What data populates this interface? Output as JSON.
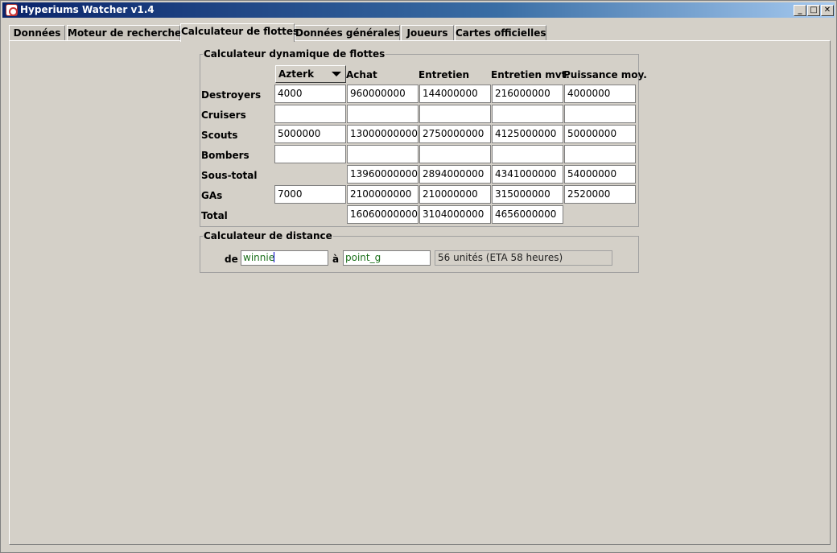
{
  "window": {
    "title": "Hyperiums Watcher v1.4",
    "minimize": "_",
    "maximize": "□",
    "close": "✕"
  },
  "tabs": [
    "Données",
    "Moteur de recherche",
    "Calculateur de flottes",
    "Données générales",
    "Joueurs",
    "Cartes officielles"
  ],
  "active_tab": "Calculateur de flottes",
  "fleet_calc": {
    "legend": "Calculateur dynamique de flottes",
    "race": "Azterk",
    "headers": [
      "Achat",
      "Entretien",
      "Entretien mvt.",
      "Puissance moy."
    ],
    "rows": [
      {
        "label": "Destroyers",
        "qty": "4000",
        "values": [
          "960000000",
          "144000000",
          "216000000",
          "4000000"
        ]
      },
      {
        "label": "Cruisers",
        "qty": "",
        "values": [
          "",
          "",
          "",
          ""
        ]
      },
      {
        "label": "Scouts",
        "qty": "5000000",
        "values": [
          "13000000000",
          "2750000000",
          "4125000000",
          "50000000"
        ]
      },
      {
        "label": "Bombers",
        "qty": "",
        "values": [
          "",
          "",
          "",
          ""
        ]
      }
    ],
    "subtotal": {
      "label": "Sous-total",
      "values": [
        "13960000000",
        "2894000000",
        "4341000000",
        "54000000"
      ]
    },
    "gas": {
      "label": "GAs",
      "qty": "7000",
      "values": [
        "2100000000",
        "210000000",
        "315000000",
        "2520000"
      ]
    },
    "total": {
      "label": "Total",
      "values": [
        "16060000000",
        "3104000000",
        "4656000000"
      ]
    }
  },
  "distance_calc": {
    "legend": "Calculateur de distance",
    "from_label": "de",
    "from_value": "winnie",
    "to_label": "à",
    "to_value": "point_g",
    "result": "56 unités (ETA 58 heures)"
  }
}
